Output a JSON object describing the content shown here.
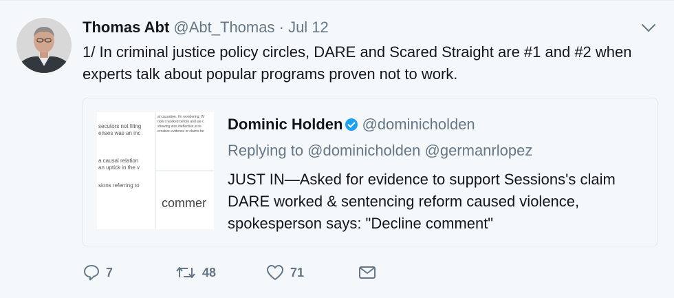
{
  "tweet": {
    "author_name": "Thomas Abt",
    "author_handle": "@Abt_Thomas",
    "separator": "·",
    "date": "Jul 12",
    "text": "1/ In criminal justice policy circles, DARE and Scared Straight are #1 and #2 when experts talk about popular programs proven not to work."
  },
  "quoted": {
    "author_name": "Dominic Holden",
    "author_handle": "@dominicholden",
    "replying_to": "Replying to @dominicholden @germanrlopez",
    "text": "JUST IN—Asked for evidence to support Sessions's claim DARE worked & sentencing reform caused violence, spokesperson says: \"Decline comment\"",
    "thumbnail_text": {
      "l1": "secutors not filing",
      "l2": "enses was an inc",
      "l3": "a causal relation",
      "l4": "an uptick in the v",
      "l5": "sions referring to",
      "r1": "al causation. I'm wondering: W",
      "r2": "now it worked before and we c",
      "r3": "showing was ineffective at re",
      "r4": "ernative evidence or claims be",
      "big": "commer"
    }
  },
  "actions": {
    "reply_count": "7",
    "retweet_count": "48",
    "like_count": "71"
  },
  "icons": {
    "reply": "reply-icon",
    "retweet": "retweet-icon",
    "like": "heart-icon",
    "dm": "envelope-icon",
    "caret": "chevron-down-icon",
    "verified": "verified-badge-icon"
  },
  "colors": {
    "background": "#f5f8fa",
    "text": "#14171a",
    "muted": "#657786",
    "verified": "#1da1f2"
  }
}
